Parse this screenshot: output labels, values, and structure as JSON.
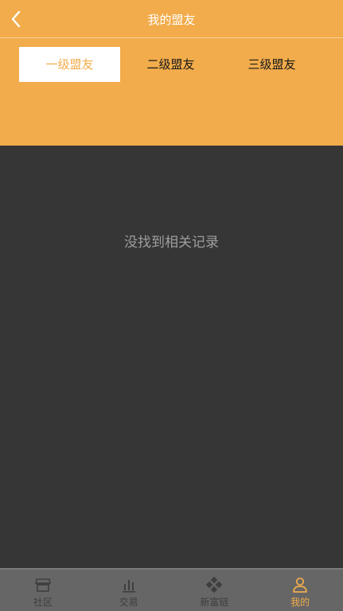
{
  "header": {
    "title": "我的盟友",
    "back_icon": "chevron-left-icon"
  },
  "tabs": [
    {
      "label": "一级盟友",
      "active": true
    },
    {
      "label": "二级盟友",
      "active": false
    },
    {
      "label": "三级盟友",
      "active": false
    }
  ],
  "content": {
    "empty_text": "没找到相关记录"
  },
  "tabbar": {
    "items": [
      {
        "label": "社区",
        "icon": "store-icon",
        "active": false
      },
      {
        "label": "交易",
        "icon": "bar-chart-icon",
        "active": false
      },
      {
        "label": "新富链",
        "icon": "diamond-grid-icon",
        "active": false
      },
      {
        "label": "我的",
        "icon": "user-icon",
        "active": true
      }
    ]
  },
  "colors": {
    "accent": "#f2ac4b",
    "background": "#363636",
    "tabbar": "#666666"
  }
}
